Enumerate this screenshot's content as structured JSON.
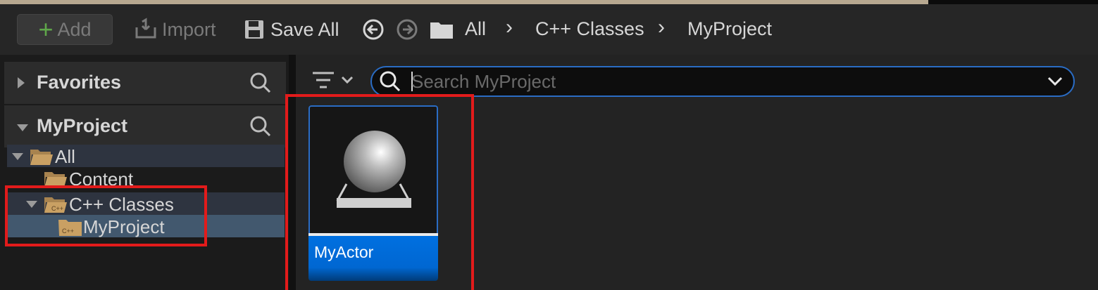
{
  "toolbar": {
    "add_label": "Add",
    "import_label": "Import",
    "save_all_label": "Save All"
  },
  "breadcrumb": [
    "All",
    "C++ Classes",
    "MyProject"
  ],
  "left_panel": {
    "favorites_label": "Favorites",
    "project_label": "MyProject",
    "tree": [
      {
        "label": "All",
        "expanded": true
      },
      {
        "label": "Content"
      },
      {
        "label": "C++ Classes",
        "expanded": true
      },
      {
        "label": "MyProject",
        "selected": true
      }
    ]
  },
  "search": {
    "placeholder": "Search MyProject"
  },
  "assets": [
    {
      "label": "MyActor",
      "icon": "actor-class-icon"
    }
  ],
  "colors": {
    "accent": "#2a6cc4",
    "selection": "#0070e0",
    "highlight_box": "#e21b1b",
    "add_plus": "#5fa74a",
    "folder": "#c9a063"
  }
}
